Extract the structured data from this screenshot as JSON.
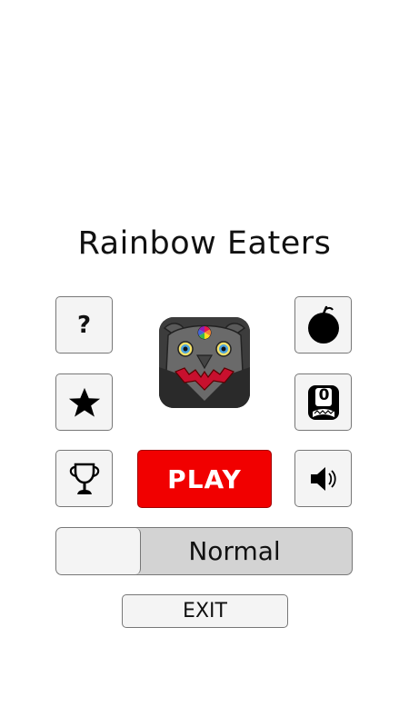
{
  "title": "Rainbow Eaters",
  "buttons": {
    "help_label": "?",
    "play_label": "PLAY",
    "exit_label": "EXIT",
    "help_icon": "question-mark",
    "star_icon": "star-icon",
    "trophy_icon": "trophy-icon",
    "bomb_icon": "bomb-icon",
    "leaderboard_icon": "zero-badge-icon",
    "leaderboard_text": "0",
    "sound_icon": "speaker-icon"
  },
  "difficulty": {
    "value": "Normal"
  },
  "colors": {
    "play": "#f10000",
    "button_bg": "#f4f4f4",
    "toggle_track": "#d3d3d3",
    "logo_bg": "#3a3a3a",
    "logo_mouth": "#c8102e"
  }
}
